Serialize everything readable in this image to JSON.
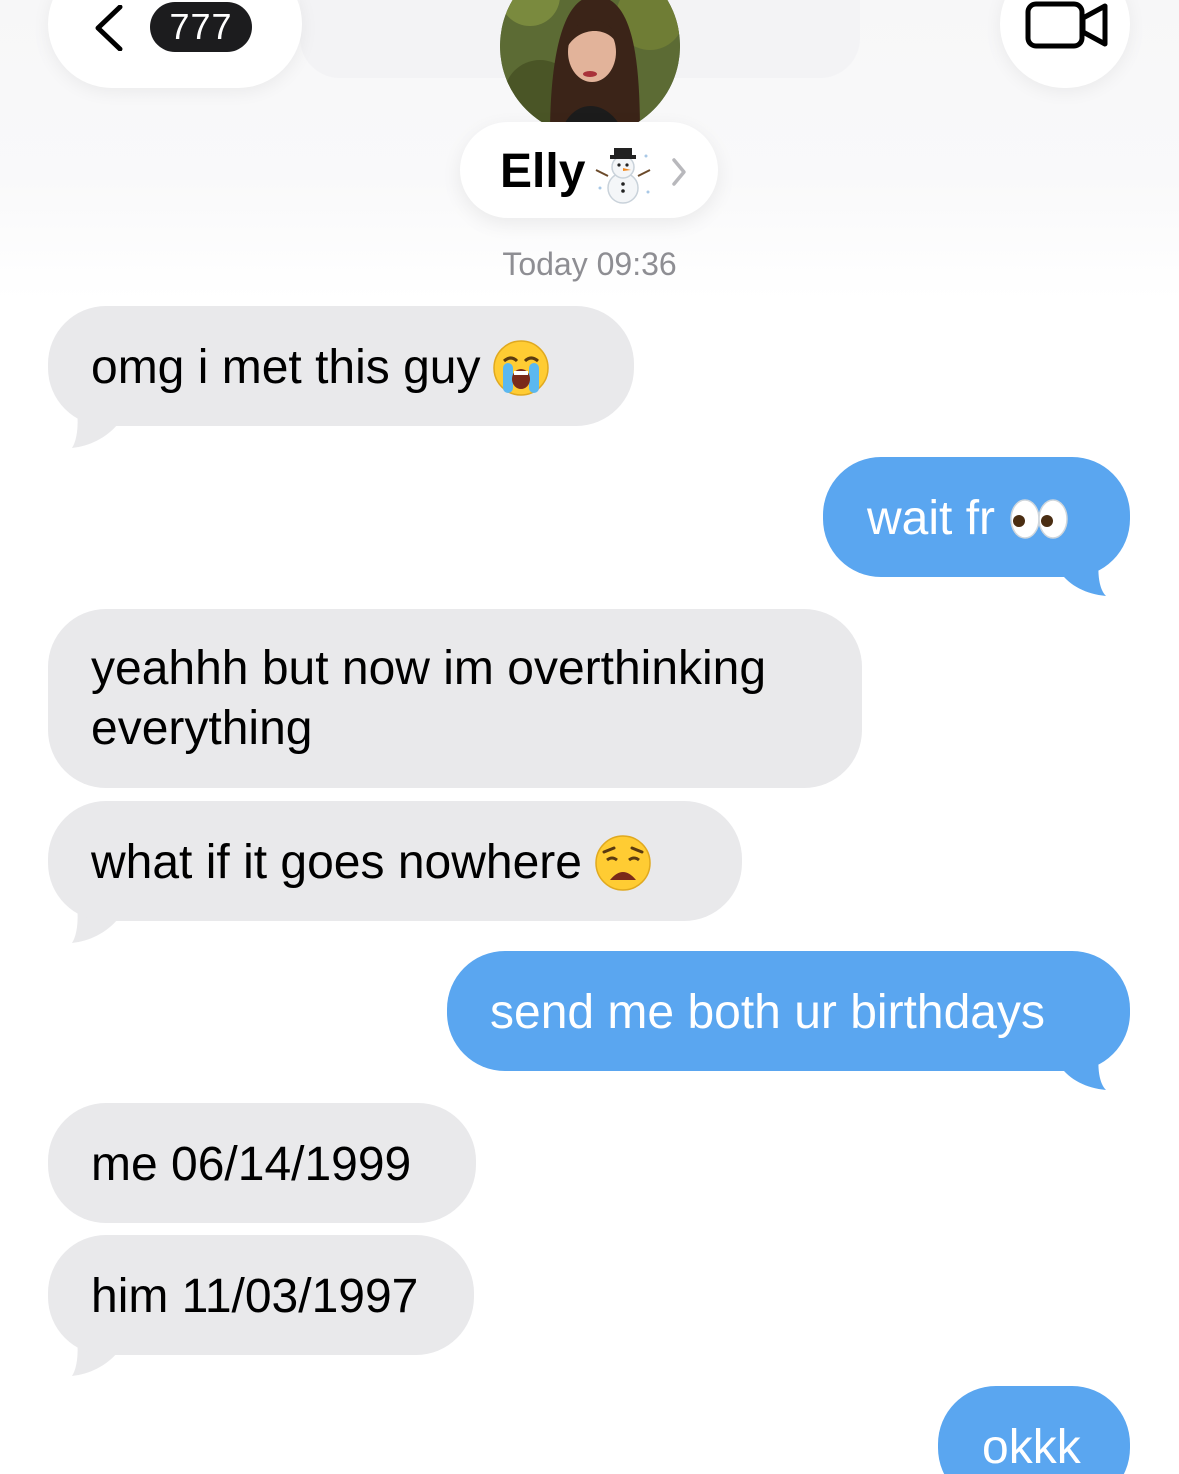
{
  "header": {
    "back_badge": "777",
    "contact_name": "Elly",
    "contact_emoji": "snowman-icon"
  },
  "conversation": {
    "timestamp": "Today 09:36",
    "messages": [
      {
        "from": "them",
        "text": "omg i met this guy",
        "emoji": "loudly-crying-face-icon"
      },
      {
        "from": "me",
        "text": "wait fr",
        "emoji": "eyes-icon"
      },
      {
        "from": "them",
        "text_line1": "yeahhh but now im overthinking",
        "text_line2": "everything"
      },
      {
        "from": "them",
        "text": "what if it goes nowhere",
        "emoji": "weary-face-icon"
      },
      {
        "from": "me",
        "text": "send me both ur birthdays"
      },
      {
        "from": "them",
        "text": "me 06/14/1999"
      },
      {
        "from": "them",
        "text": "him 11/03/1997"
      },
      {
        "from": "me",
        "text": "okkk"
      }
    ]
  },
  "colors": {
    "incoming_bubble": "#e9e9eb",
    "outgoing_bubble": "#5aa6f0",
    "timestamp": "#8e8e93"
  }
}
